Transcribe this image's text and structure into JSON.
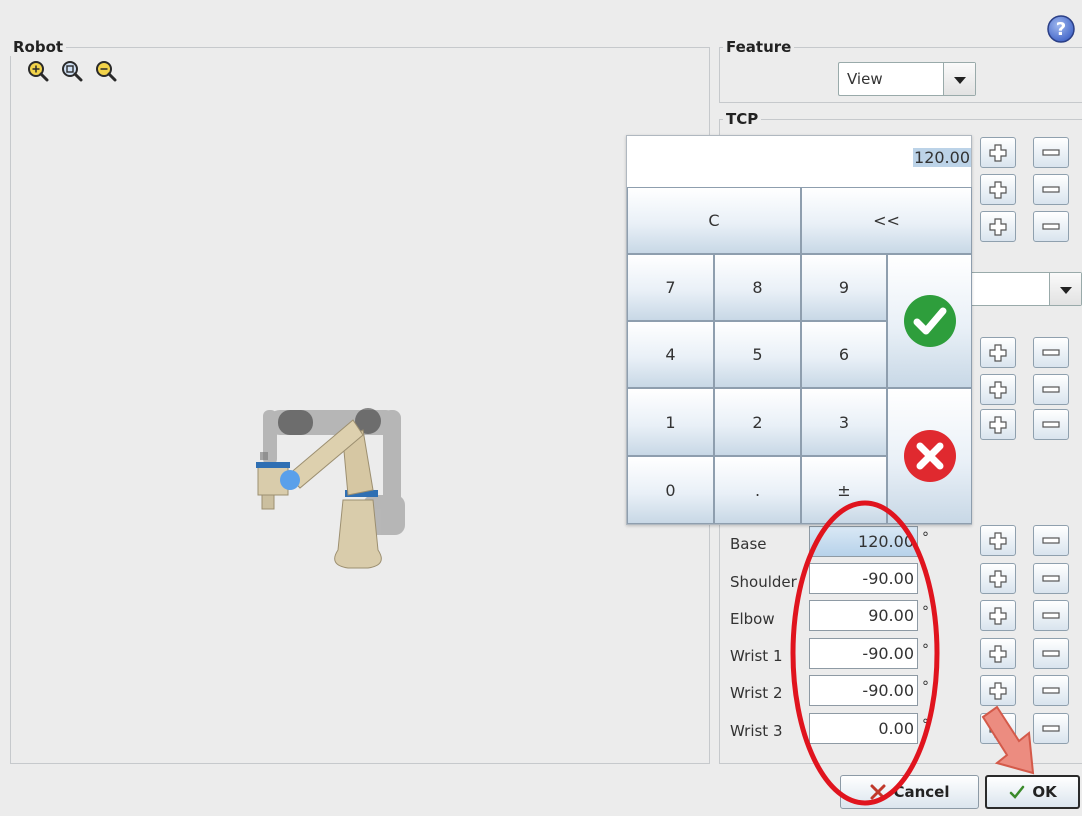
{
  "help": {
    "icon": "question-circle-icon"
  },
  "robot_panel": {
    "title": "Robot",
    "zoom_in_icon": "zoom-in-icon",
    "zoom_fit_icon": "zoom-fit-icon",
    "zoom_out_icon": "zoom-out-icon"
  },
  "feature_panel": {
    "title": "Feature",
    "selected": "View"
  },
  "tcp_panel": {
    "title": "TCP"
  },
  "keypad": {
    "display_value": "120.00",
    "clear_label": "C",
    "backspace_label": "<<",
    "digits": [
      "7",
      "8",
      "9",
      "4",
      "5",
      "6",
      "1",
      "2",
      "3",
      "0",
      ".",
      "±"
    ],
    "accept_icon": "checkmark-icon",
    "cancel_icon": "cancel-x-icon",
    "accept_color": "#2e9e3c",
    "cancel_color": "#e0292f"
  },
  "joints": [
    {
      "label": "Base",
      "value": "120.00",
      "unit": "°"
    },
    {
      "label": "Shoulder",
      "value": "-90.00",
      "unit": "°"
    },
    {
      "label": "Elbow",
      "value": "90.00",
      "unit": "°"
    },
    {
      "label": "Wrist 1",
      "value": "-90.00",
      "unit": "°"
    },
    {
      "label": "Wrist 2",
      "value": "-90.00",
      "unit": "°"
    },
    {
      "label": "Wrist 3",
      "value": "0.00",
      "unit": "°"
    }
  ],
  "buttons": {
    "cancel": "Cancel",
    "ok": "OK"
  },
  "annotation_colors": {
    "circle": "#e0141e",
    "arrow": "#ec8c80"
  }
}
